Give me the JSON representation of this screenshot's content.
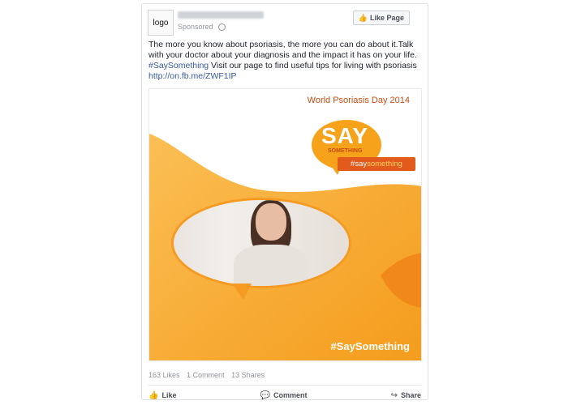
{
  "post": {
    "logo_text": "logo",
    "sponsored": "Sponsored",
    "like_page_label": "Like Page",
    "text_line1": "The more you know about psoriasis, the more you can do about it.Talk with your doctor about your diagnosis and the impact it has on your life.",
    "hashtag": "#SaySomething",
    "text_line2": " Visit our page to find useful tips for living with psoriasis",
    "link": "http://on.fb.me/ZWF1IP"
  },
  "image": {
    "event_title": "World Psoriasis Day 2014",
    "say_text": "SAY",
    "something_text": "SOMETHING",
    "hashtag_prefix": "#say",
    "hashtag_suffix": "something",
    "bottom_hashtag": "#SaySomething"
  },
  "counts": {
    "likes": "163 Likes",
    "comments": "1 Comment",
    "shares": "13 Shares"
  },
  "actions": {
    "like": "Like",
    "comment": "Comment",
    "share": "Share"
  },
  "colors": {
    "brand_blue": "#365899",
    "orange": "#f7a21b",
    "deep_orange": "#e25a1c"
  },
  "icons": {
    "like_icon": "thumbs-up-icon",
    "comment_icon": "comment-icon",
    "share_icon": "share-icon",
    "globe_icon": "globe-icon"
  }
}
